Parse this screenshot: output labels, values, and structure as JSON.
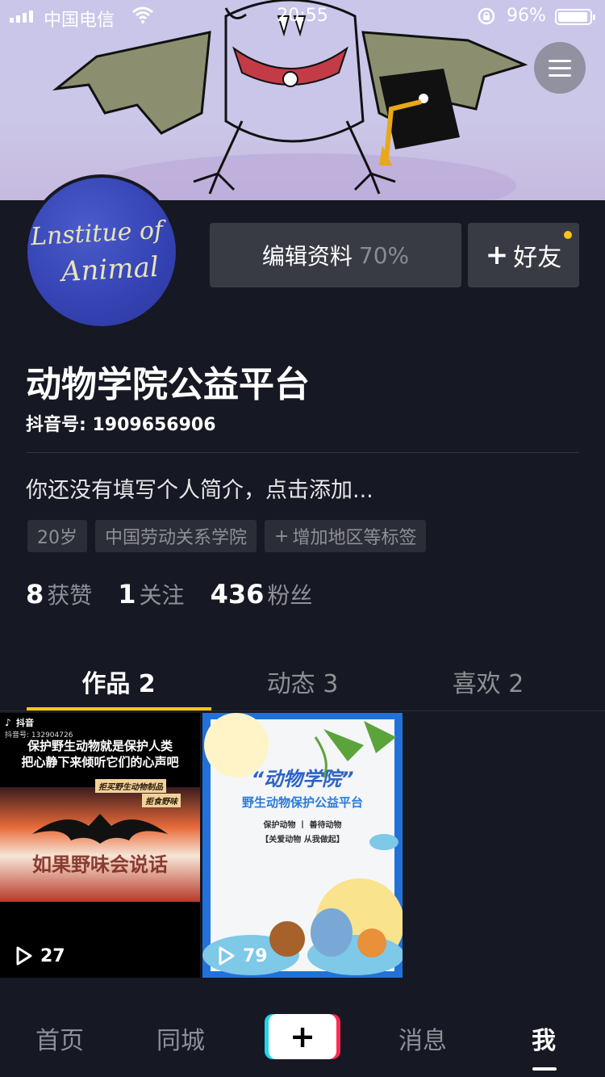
{
  "status_bar": {
    "carrier": "中国电信",
    "time": "20:55",
    "battery": "96%",
    "battery_level": 0.96
  },
  "profile": {
    "avatar_text_line1": "Lnstitue of",
    "avatar_text_line2": "Animal",
    "edit_button_label": "编辑资料",
    "edit_button_percent": "70%",
    "friend_button_label": "好友",
    "nickname": "动物学院公益平台",
    "douyin_id": "抖音号: 1909656906",
    "bio_placeholder": "你还没有填写个人简介，点击添加...",
    "tags": [
      "20岁",
      "中国劳动关系学院",
      "增加地区等标签"
    ]
  },
  "stats": [
    {
      "value": "8",
      "label": "获赞"
    },
    {
      "value": "1",
      "label": "关注"
    },
    {
      "value": "436",
      "label": "粉丝"
    }
  ],
  "tabs": [
    {
      "label": "作品 2"
    },
    {
      "label": "动态 3"
    },
    {
      "label": "喜欢 2"
    }
  ],
  "videos": [
    {
      "logo": "抖音",
      "account": "抖音号: 132904726",
      "line1": "保护野生动物就是保护人类",
      "line2": "把心静下来倾听它们的心声吧",
      "banner1": "拒买野生动物制品",
      "banner2": "拒食野味",
      "caption": "如果野味会说话",
      "plays": "27"
    },
    {
      "title": "“动物学院”",
      "subtitle": "野生动物保护公益平台",
      "slogan": "保护动物 丨 善待动物",
      "tagline": "【关爱动物 从我做起】",
      "plays": "79"
    }
  ],
  "bottom_nav": {
    "home": "首页",
    "city": "同城",
    "add": "+",
    "messages": "消息",
    "me": "我"
  }
}
